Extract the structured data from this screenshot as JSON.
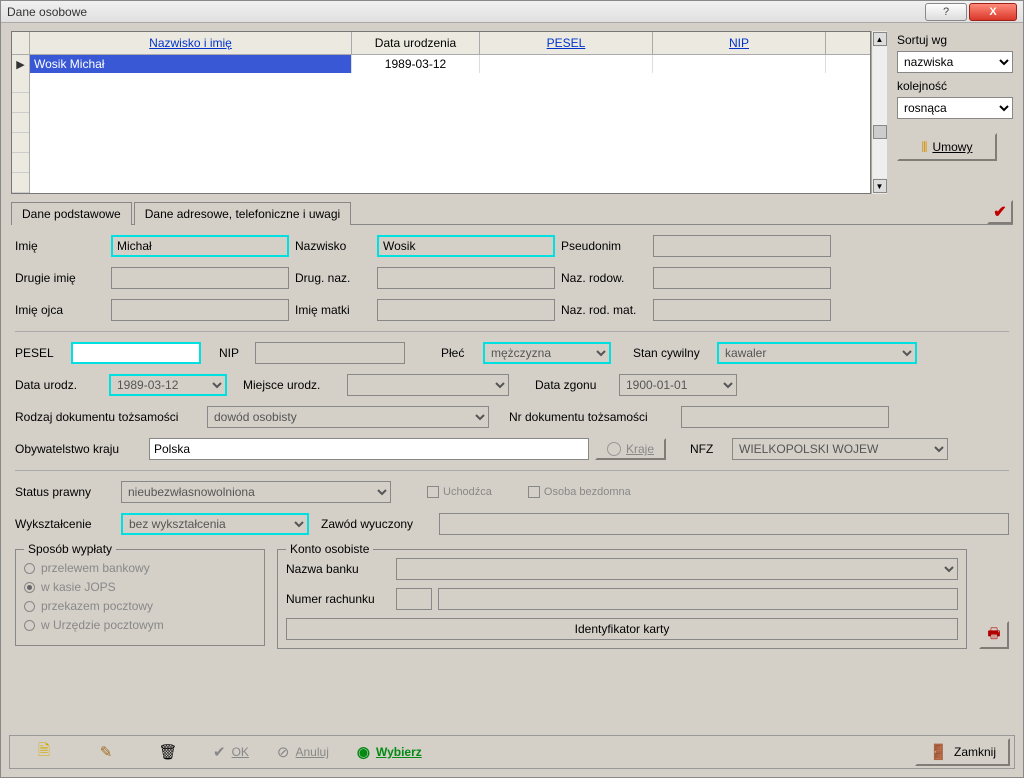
{
  "window": {
    "title": "Dane osobowe"
  },
  "grid": {
    "headers": {
      "name": "Nazwisko i imię",
      "dob": "Data urodzenia",
      "pesel": "PESEL",
      "nip": "NIP"
    },
    "row1": {
      "name": "Wosik Michał",
      "dob": "1989-03-12"
    }
  },
  "sort": {
    "sortby_label": "Sortuj wg",
    "sortby_value": "nazwiska",
    "order_label": "kolejność",
    "order_value": "rosnąca",
    "umowy_label": "Umowy"
  },
  "tabs": {
    "basic": "Dane podstawowe",
    "address": "Dane adresowe, telefoniczne i uwagi"
  },
  "form": {
    "imie_lbl": "Imię",
    "imie_val": "Michał",
    "nazwisko_lbl": "Nazwisko",
    "nazwisko_val": "Wosik",
    "pseudonim_lbl": "Pseudonim",
    "drugie_imie_lbl": "Drugie imię",
    "drug_naz_lbl": "Drug. naz.",
    "naz_rodow_lbl": "Naz. rodow.",
    "imie_ojca_lbl": "Imię ojca",
    "imie_matki_lbl": "Imię matki",
    "naz_rod_mat_lbl": "Naz. rod. mat.",
    "pesel_lbl": "PESEL",
    "nip_lbl": "NIP",
    "plec_lbl": "Płeć",
    "plec_val": "mężczyzna",
    "stan_lbl": "Stan cywilny",
    "stan_val": "kawaler",
    "data_urodz_lbl": "Data urodz.",
    "data_urodz_val": "1989-03-12",
    "miejsce_urodz_lbl": "Miejsce urodz.",
    "data_zgonu_lbl": "Data zgonu",
    "data_zgonu_val": "1900-01-01",
    "rodzaj_dok_lbl": "Rodzaj dokumentu tożsamości",
    "rodzaj_dok_val": "dowód osobisty",
    "nr_dok_lbl": "Nr dokumentu tożsamości",
    "obywatelstwo_lbl": "Obywatelstwo kraju",
    "obywatelstwo_val": "Polska",
    "kraje_lbl": "Kraje",
    "nfz_lbl": "NFZ",
    "nfz_val": "WIELKOPOLSKI WOJEW",
    "status_lbl": "Status prawny",
    "status_val": "nieubezwłasnowolniona",
    "uchodzca_lbl": "Uchodźca",
    "bezdomna_lbl": "Osoba bezdomna",
    "wyksztalcenie_lbl": "Wykształcenie",
    "wyksztalcenie_val": "bez wykształcenia",
    "zawod_lbl": "Zawód wyuczony"
  },
  "payment_group": {
    "legend": "Sposób wypłaty",
    "opt1": "przelewem bankowy",
    "opt2": "w kasie JOPS",
    "opt3": "przekazem pocztowy",
    "opt4": "w Urzędzie pocztowym"
  },
  "account_group": {
    "legend": "Konto osobiste",
    "bank_lbl": "Nazwa banku",
    "acct_lbl": "Numer rachunku",
    "card_id_lbl": "Identyfikator karty"
  },
  "buttons": {
    "ok": "OK",
    "anuluj": "Anuluj",
    "wybierz": "Wybierz",
    "zamknij": "Zamknij"
  }
}
